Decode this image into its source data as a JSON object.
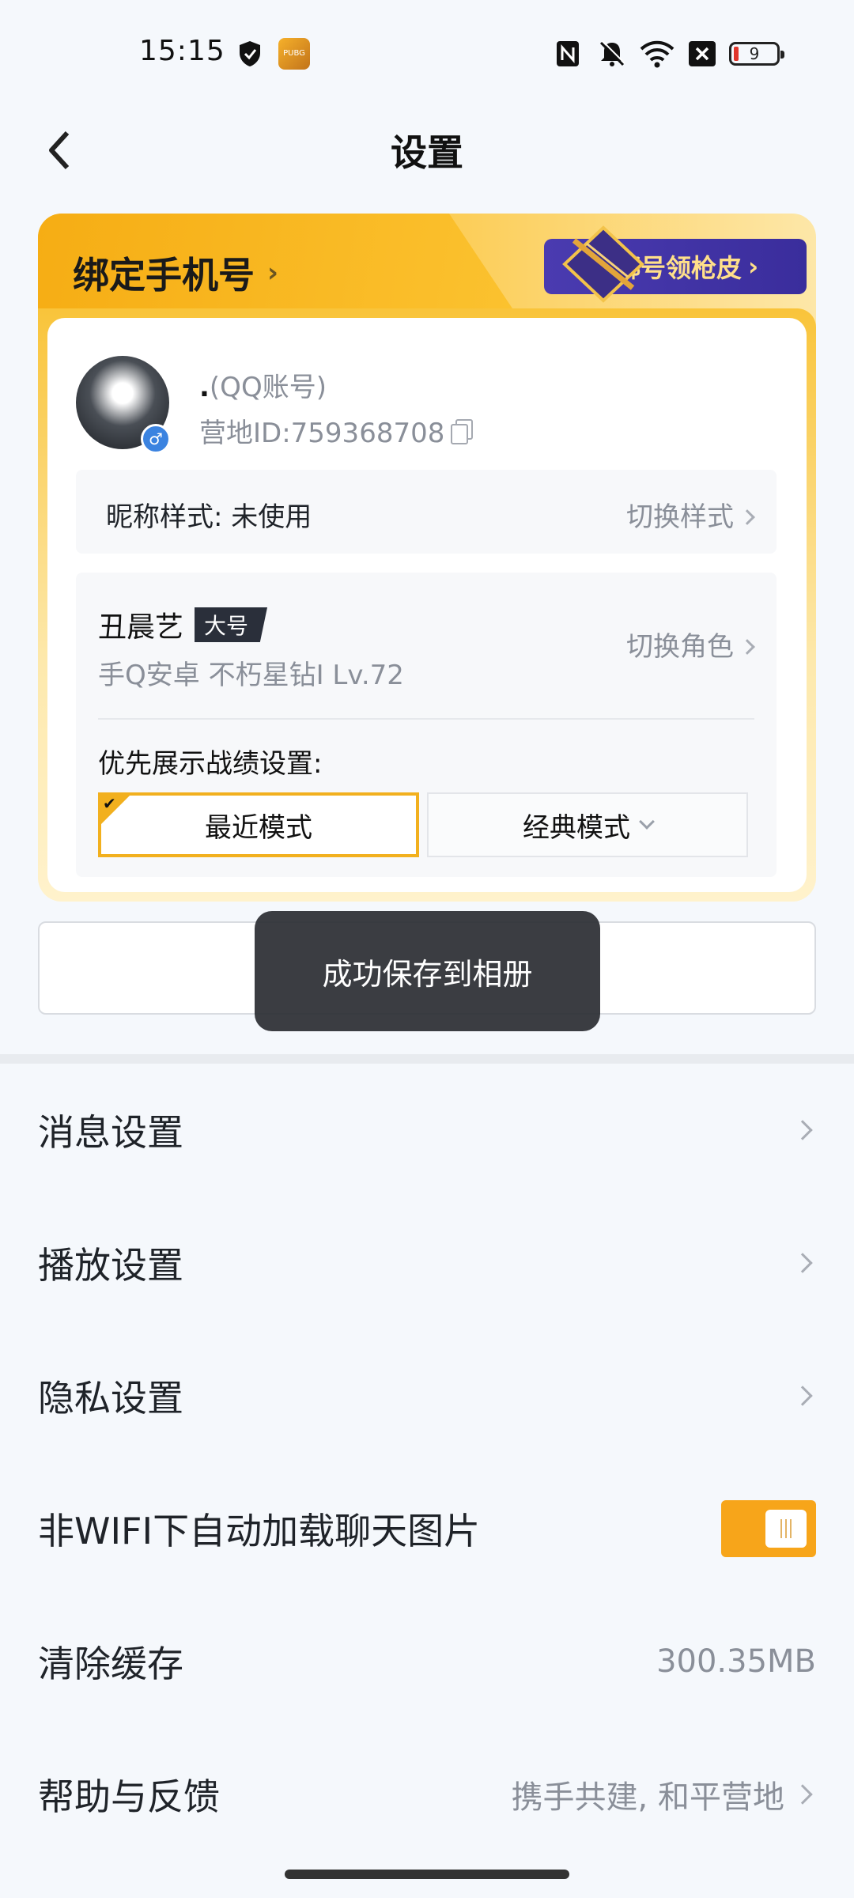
{
  "status_bar": {
    "time": "15:15",
    "battery": "9",
    "icons": [
      "shield-icon",
      "app-badge-icon",
      "nfc-icon",
      "mute-icon",
      "wifi-icon",
      "sim-off-icon",
      "battery-icon"
    ]
  },
  "header": {
    "title": "设置",
    "back_icon": "back-arrow-icon"
  },
  "card": {
    "bind_phone": "绑定手机号",
    "reward": "绑号领枪皮",
    "account_dot": ".",
    "account_type": "(QQ账号)",
    "camp_id": "营地ID:759368708",
    "nickname_style_label": "昵称样式: 未使用",
    "nickname_style_action": "切换样式",
    "role_name": "丑晨艺",
    "role_tag": "大号",
    "role_info": "手Q安卓  不朽星钻I  Lv.72",
    "role_action": "切换角色",
    "pref_label": "优先展示战绩设置:",
    "mode_recent": "最近模式",
    "mode_classic": "经典模式"
  },
  "toast": "成功保存到相册",
  "menu": {
    "message": "消息设置",
    "playback": "播放设置",
    "privacy": "隐私设置",
    "auto_load": "非WIFI下自动加载聊天图片",
    "auto_load_on": true,
    "clear_cache": "清除缓存",
    "cache_size": "300.35MB",
    "help": "帮助与反馈",
    "help_sub": "携手共建, 和平营地"
  },
  "colors": {
    "accent": "#f7a51a",
    "background": "#f5f8fc",
    "card_gold": "#f8b91c"
  }
}
